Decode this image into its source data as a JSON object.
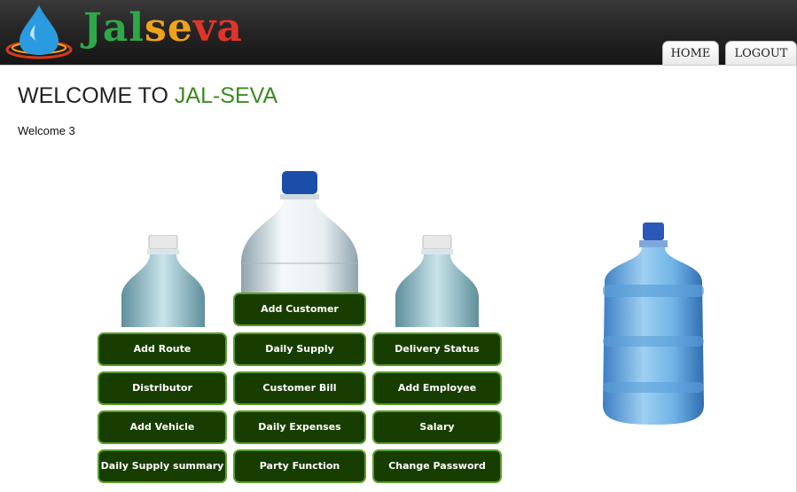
{
  "header": {
    "logo_alt": "JalSeva",
    "logo_parts": [
      "Jal",
      "se",
      "va"
    ],
    "tabs": {
      "home": "HOME",
      "logout": "LOGOUT"
    }
  },
  "main": {
    "title_prefix": "WELCOME TO ",
    "title_accent": "JAL-SEVA",
    "welcome_text": "Welcome 3"
  },
  "menu": {
    "add_customer": "Add Customer",
    "add_route": "Add Route",
    "daily_supply": "Daily Supply",
    "delivery_status": "Delivery Status",
    "distributor": "Distributor",
    "customer_bill": "Customer Bill",
    "add_employee": "Add Employee",
    "add_vehicle": "Add Vehicle",
    "daily_expenses": "Daily Expenses",
    "salary": "Salary",
    "daily_supply_summary": "Daily Supply summary",
    "party_function": "Party Function",
    "change_password": "Change Password"
  },
  "colors": {
    "button_bg": "#183d00",
    "button_border": "#5a9e2a",
    "accent_green": "#3c8a20",
    "header_dark": "#1e1e1e"
  },
  "icons": [
    "water-drop-logo-icon",
    "water-bottle-image",
    "water-jar-image"
  ]
}
